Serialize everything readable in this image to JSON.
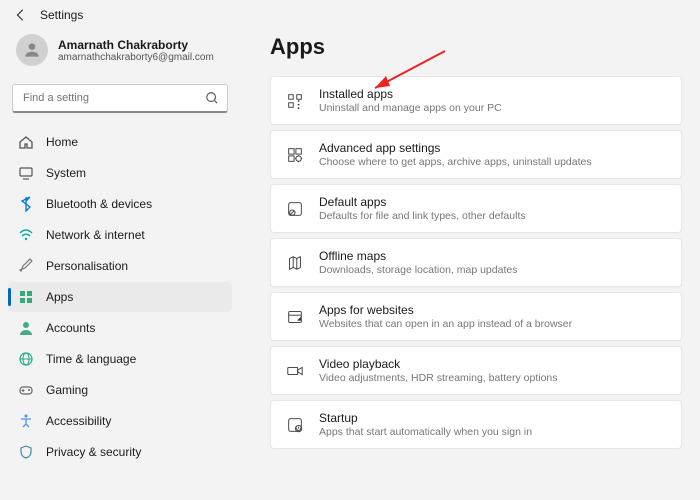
{
  "titlebar": {
    "title": "Settings"
  },
  "profile": {
    "name": "Amarnath Chakraborty",
    "email": "amarnathchakraborty6@gmail.com"
  },
  "search": {
    "placeholder": "Find a setting"
  },
  "nav": [
    {
      "label": "Home",
      "icon": "home",
      "active": false
    },
    {
      "label": "System",
      "icon": "system",
      "active": false
    },
    {
      "label": "Bluetooth & devices",
      "icon": "bluetooth",
      "active": false
    },
    {
      "label": "Network & internet",
      "icon": "wifi",
      "active": false
    },
    {
      "label": "Personalisation",
      "icon": "brush",
      "active": false
    },
    {
      "label": "Apps",
      "icon": "apps",
      "active": true
    },
    {
      "label": "Accounts",
      "icon": "person",
      "active": false
    },
    {
      "label": "Time & language",
      "icon": "globe",
      "active": false
    },
    {
      "label": "Gaming",
      "icon": "gaming",
      "active": false
    },
    {
      "label": "Accessibility",
      "icon": "access",
      "active": false
    },
    {
      "label": "Privacy & security",
      "icon": "shield",
      "active": false
    }
  ],
  "main": {
    "heading": "Apps",
    "cards": [
      {
        "title": "Installed apps",
        "desc": "Uninstall and manage apps on your PC",
        "icon": "installed"
      },
      {
        "title": "Advanced app settings",
        "desc": "Choose where to get apps, archive apps, uninstall updates",
        "icon": "advanced"
      },
      {
        "title": "Default apps",
        "desc": "Defaults for file and link types, other defaults",
        "icon": "default"
      },
      {
        "title": "Offline maps",
        "desc": "Downloads, storage location, map updates",
        "icon": "maps"
      },
      {
        "title": "Apps for websites",
        "desc": "Websites that can open in an app instead of a browser",
        "icon": "websites"
      },
      {
        "title": "Video playback",
        "desc": "Video adjustments, HDR streaming, battery options",
        "icon": "video"
      },
      {
        "title": "Startup",
        "desc": "Apps that start automatically when you sign in",
        "icon": "startup"
      }
    ]
  },
  "colors": {
    "accent": "#0067c0",
    "arrow": "#e22222"
  }
}
